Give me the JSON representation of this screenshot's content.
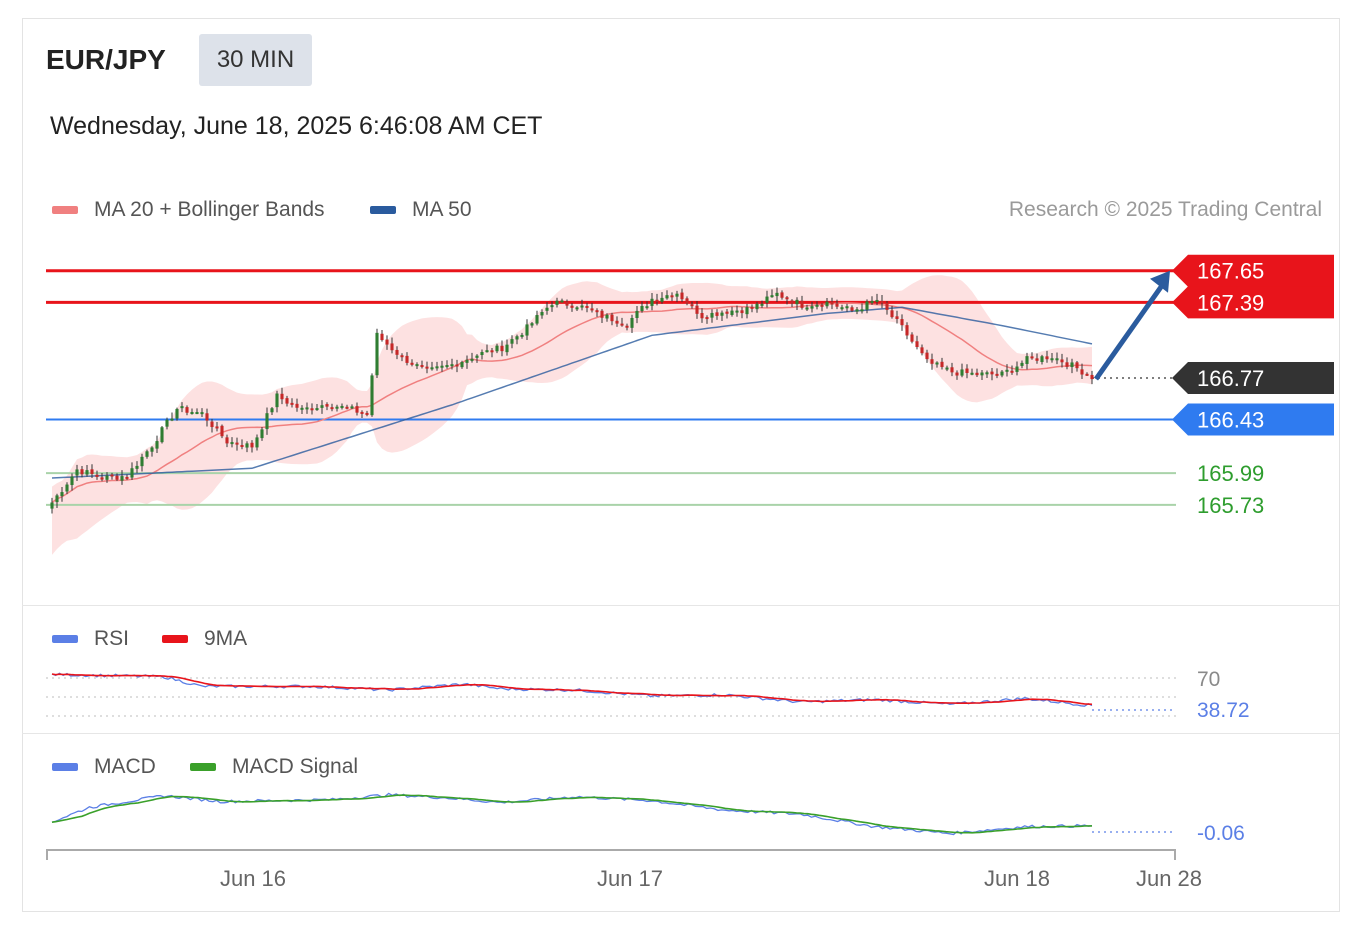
{
  "header": {
    "symbol": "EUR/JPY",
    "timeframe": "30 MIN",
    "timestamp": "Wednesday, June 18, 2025 6:46:08 AM CET",
    "credit": "Research © 2025 Trading Central"
  },
  "colors": {
    "resistance": "#e8141b",
    "pivot": "#2f7bf0",
    "support": "#2e9d2e",
    "current": "#333333",
    "candle_up": "#2f7d32",
    "candle_down": "#c62828",
    "ma20": "#f08080",
    "ma50": "#2a5b9e",
    "bands": "#fddcdc",
    "rsi": "#5b7fe6",
    "rsi_ma": "#e8141b",
    "macd": "#5b7fe6",
    "macd_signal": "#3aa02a",
    "arrow": "#2a5b9e"
  },
  "chart_data": [
    {
      "type": "candlestick",
      "title": "EUR/JPY 30 MIN",
      "legend": [
        {
          "name": "MA 20 + Bollinger Bands",
          "color": "#f08080"
        },
        {
          "name": "MA 50",
          "color": "#2a5b9e"
        }
      ],
      "x_ticks": [
        "Jun 16",
        "Jun 17",
        "Jun 18",
        "Jun 28"
      ],
      "ylim": [
        164.95,
        168.0
      ],
      "levels": [
        {
          "name": "resistance-2",
          "value": 167.65,
          "label": "167.65",
          "style": "resistance"
        },
        {
          "name": "resistance-1",
          "value": 167.39,
          "label": "167.39",
          "style": "resistance"
        },
        {
          "name": "current-price",
          "value": 166.77,
          "label": "166.77",
          "style": "current"
        },
        {
          "name": "pivot",
          "value": 166.43,
          "label": "166.43",
          "style": "pivot"
        },
        {
          "name": "support-1",
          "value": 165.99,
          "label": "165.99",
          "style": "support"
        },
        {
          "name": "support-2",
          "value": 165.73,
          "label": "165.73",
          "style": "support"
        }
      ],
      "close_anchors": [
        [
          0,
          165.75
        ],
        [
          5,
          166.02
        ],
        [
          10,
          165.95
        ],
        [
          15,
          165.97
        ],
        [
          20,
          166.22
        ],
        [
          25,
          166.52
        ],
        [
          30,
          166.48
        ],
        [
          35,
          166.25
        ],
        [
          40,
          166.21
        ],
        [
          45,
          166.62
        ],
        [
          50,
          166.51
        ],
        [
          55,
          166.56
        ],
        [
          60,
          166.51
        ],
        [
          63,
          166.47
        ],
        [
          65,
          167.12
        ],
        [
          70,
          166.94
        ],
        [
          75,
          166.82
        ],
        [
          80,
          166.88
        ],
        [
          85,
          166.96
        ],
        [
          90,
          167.02
        ],
        [
          95,
          167.18
        ],
        [
          100,
          167.39
        ],
        [
          105,
          167.37
        ],
        [
          110,
          167.28
        ],
        [
          115,
          167.22
        ],
        [
          120,
          167.42
        ],
        [
          125,
          167.47
        ],
        [
          130,
          167.28
        ],
        [
          135,
          167.32
        ],
        [
          140,
          167.34
        ],
        [
          145,
          167.46
        ],
        [
          150,
          167.37
        ],
        [
          155,
          167.39
        ],
        [
          160,
          167.32
        ],
        [
          165,
          167.41
        ],
        [
          170,
          167.18
        ],
        [
          175,
          166.9
        ],
        [
          180,
          166.82
        ],
        [
          185,
          166.8
        ],
        [
          190,
          166.8
        ],
        [
          195,
          166.92
        ],
        [
          200,
          166.95
        ],
        [
          205,
          166.85
        ],
        [
          208,
          166.78
        ]
      ],
      "ma_anchors": [
        [
          0,
          165.95
        ],
        [
          40,
          166.03
        ],
        [
          80,
          166.55
        ],
        [
          120,
          167.12
        ],
        [
          155,
          167.3
        ],
        [
          170,
          167.35
        ],
        [
          190,
          167.2
        ],
        [
          208,
          167.05
        ]
      ],
      "projection_target": 167.65
    },
    {
      "type": "line",
      "legend": [
        {
          "name": "RSI",
          "color": "#5b7fe6"
        },
        {
          "name": "9MA",
          "color": "#e8141b"
        }
      ],
      "reference_level": "70",
      "current_value": "38.72",
      "ylim": [
        30,
        80
      ],
      "anchors": [
        [
          0,
          68
        ],
        [
          30,
          66
        ],
        [
          40,
          58
        ],
        [
          70,
          58
        ],
        [
          90,
          55
        ],
        [
          110,
          60
        ],
        [
          120,
          56
        ],
        [
          140,
          55
        ],
        [
          160,
          50
        ],
        [
          180,
          51
        ],
        [
          200,
          45
        ],
        [
          220,
          47
        ],
        [
          240,
          43
        ],
        [
          260,
          48
        ],
        [
          278,
          42
        ]
      ]
    },
    {
      "type": "line",
      "legend": [
        {
          "name": "MACD",
          "color": "#5b7fe6"
        },
        {
          "name": "MACD Signal",
          "color": "#3aa02a"
        }
      ],
      "current_value": "-0.06",
      "ylim": [
        -0.3,
        0.3
      ],
      "anchors": [
        [
          0,
          -0.05
        ],
        [
          10,
          0.1
        ],
        [
          30,
          0.22
        ],
        [
          45,
          0.16
        ],
        [
          60,
          0.17
        ],
        [
          75,
          0.18
        ],
        [
          90,
          0.23
        ],
        [
          105,
          0.2
        ],
        [
          120,
          0.15
        ],
        [
          140,
          0.21
        ],
        [
          160,
          0.17
        ],
        [
          180,
          0.07
        ],
        [
          200,
          0.03
        ],
        [
          220,
          -0.1
        ],
        [
          240,
          -0.17
        ],
        [
          260,
          -0.1
        ],
        [
          278,
          -0.09
        ]
      ]
    }
  ]
}
